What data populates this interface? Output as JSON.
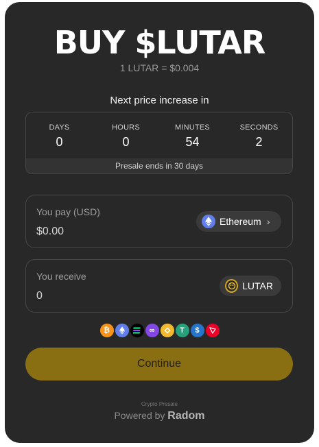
{
  "header": {
    "title": "BUY $LUTAR",
    "rate": "1 LUTAR = $0.004"
  },
  "countdown": {
    "label": "Next price increase in",
    "units": [
      {
        "unit": "DAYS",
        "value": "0"
      },
      {
        "unit": "HOURS",
        "value": "0"
      },
      {
        "unit": "MINUTES",
        "value": "54"
      },
      {
        "unit": "SECONDS",
        "value": "2"
      }
    ],
    "footer": "Presale ends in 30 days"
  },
  "pay": {
    "label": "You pay (USD)",
    "value": "$0.00",
    "token": "Ethereum",
    "token_icon": "ethereum-icon"
  },
  "receive": {
    "label": "You receive",
    "value": "0",
    "token": "LUTAR",
    "token_icon": "lutar-token-icon"
  },
  "accepted_coins": [
    {
      "name": "bitcoin-icon",
      "color": "#f7931a"
    },
    {
      "name": "ethereum-icon",
      "color": "#627eea"
    },
    {
      "name": "solana-icon",
      "color": "#000000"
    },
    {
      "name": "polygon-icon",
      "color": "#8247e5"
    },
    {
      "name": "bnb-icon",
      "color": "#f3ba2f"
    },
    {
      "name": "tether-icon",
      "color": "#26a17b"
    },
    {
      "name": "usdc-icon",
      "color": "#2775ca"
    },
    {
      "name": "tron-icon",
      "color": "#eb0029"
    }
  ],
  "actions": {
    "continue_label": "Continue",
    "accent_color": "#8a6e12"
  },
  "footer": {
    "small": "Crypto Presale",
    "powered": "Powered by",
    "brand": "Radom"
  }
}
